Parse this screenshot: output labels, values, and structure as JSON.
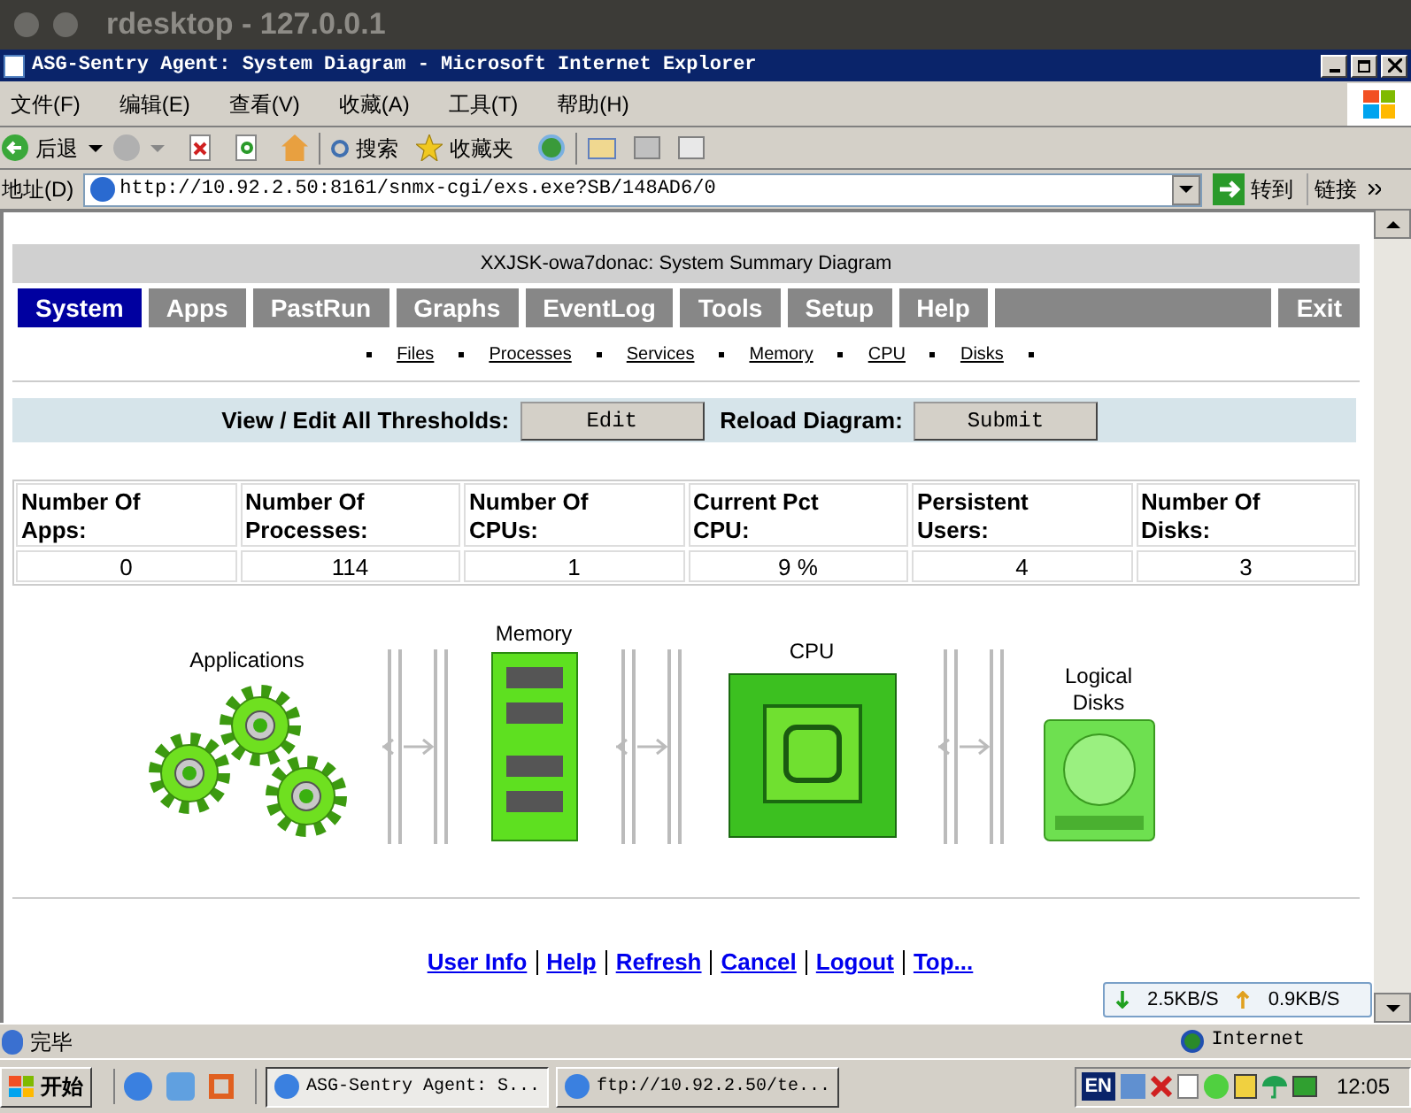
{
  "outer_window": {
    "title": "rdesktop - 127.0.0.1"
  },
  "window": {
    "title": "ASG-Sentry Agent: System Diagram - Microsoft Internet Explorer"
  },
  "menu": [
    "文件(F)",
    "编辑(E)",
    "查看(V)",
    "收藏(A)",
    "工具(T)",
    "帮助(H)"
  ],
  "toolbar": {
    "back": "后退",
    "search": "搜索",
    "favorites": "收藏夹"
  },
  "address_bar": {
    "label": "地址(D)",
    "value": "http://10.92.2.50:8161/snmx-cgi/exs.exe?SB/148AD6/0",
    "go": "转到",
    "links": "链接"
  },
  "page": {
    "header": "XXJSK-owa7donac: System Summary Diagram",
    "tabs": [
      {
        "label": "System",
        "selected": true
      },
      {
        "label": "Apps",
        "selected": false
      },
      {
        "label": "PastRun",
        "selected": false
      },
      {
        "label": "Graphs",
        "selected": false
      },
      {
        "label": "EventLog",
        "selected": false
      },
      {
        "label": "Tools",
        "selected": false
      },
      {
        "label": "Setup",
        "selected": false
      },
      {
        "label": "Help",
        "selected": false
      },
      {
        "label": "Exit",
        "selected": false
      }
    ],
    "sub_links": [
      "Files",
      "Processes",
      "Services",
      "Memory",
      "CPU",
      "Disks"
    ],
    "thresholds": {
      "label": "View / Edit All Thresholds:",
      "edit": "Edit",
      "reload_label": "Reload Diagram:",
      "submit": "Submit"
    },
    "stats": [
      {
        "label": "Number Of Apps:",
        "value": "0"
      },
      {
        "label": "Number Of Processes:",
        "value": "114"
      },
      {
        "label": "Number Of CPUs:",
        "value": "1"
      },
      {
        "label": "Current Pct CPU:",
        "value": "9 %"
      },
      {
        "label": "Persistent Users:",
        "value": "4"
      },
      {
        "label": "Number Of Disks:",
        "value": "3"
      }
    ],
    "diagram": {
      "applications": "Applications",
      "memory": "Memory",
      "cpu": "CPU",
      "disks": "Logical Disks"
    },
    "footer_links": [
      "User Info",
      "Help",
      "Refresh",
      "Cancel",
      "Logout",
      "Top..."
    ]
  },
  "net_speed": {
    "down": "2.5KB/S",
    "up": "0.9KB/S"
  },
  "status_bar": {
    "text": "完毕",
    "zone": "Internet"
  },
  "taskbar": {
    "start": "开始",
    "tasks": [
      {
        "label": "ASG-Sentry Agent: S...",
        "selected": true
      },
      {
        "label": "ftp://10.92.2.50/te...",
        "selected": false
      }
    ],
    "language": "EN",
    "clock": "12:05"
  }
}
